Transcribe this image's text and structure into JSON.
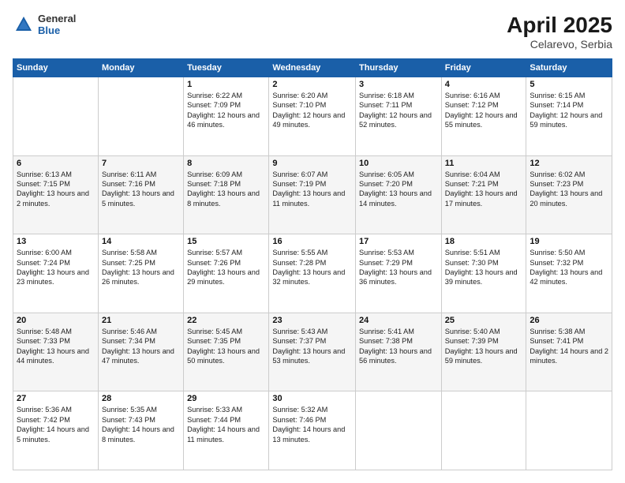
{
  "header": {
    "logo": {
      "general": "General",
      "blue": "Blue"
    },
    "title": "April 2025",
    "location": "Celarevo, Serbia"
  },
  "weekdays": [
    "Sunday",
    "Monday",
    "Tuesday",
    "Wednesday",
    "Thursday",
    "Friday",
    "Saturday"
  ],
  "weeks": [
    [
      null,
      null,
      {
        "day": "1",
        "sunrise": "6:22 AM",
        "sunset": "7:09 PM",
        "daylight": "12 hours and 46 minutes."
      },
      {
        "day": "2",
        "sunrise": "6:20 AM",
        "sunset": "7:10 PM",
        "daylight": "12 hours and 49 minutes."
      },
      {
        "day": "3",
        "sunrise": "6:18 AM",
        "sunset": "7:11 PM",
        "daylight": "12 hours and 52 minutes."
      },
      {
        "day": "4",
        "sunrise": "6:16 AM",
        "sunset": "7:12 PM",
        "daylight": "12 hours and 55 minutes."
      },
      {
        "day": "5",
        "sunrise": "6:15 AM",
        "sunset": "7:14 PM",
        "daylight": "12 hours and 59 minutes."
      }
    ],
    [
      {
        "day": "6",
        "sunrise": "6:13 AM",
        "sunset": "7:15 PM",
        "daylight": "13 hours and 2 minutes."
      },
      {
        "day": "7",
        "sunrise": "6:11 AM",
        "sunset": "7:16 PM",
        "daylight": "13 hours and 5 minutes."
      },
      {
        "day": "8",
        "sunrise": "6:09 AM",
        "sunset": "7:18 PM",
        "daylight": "13 hours and 8 minutes."
      },
      {
        "day": "9",
        "sunrise": "6:07 AM",
        "sunset": "7:19 PM",
        "daylight": "13 hours and 11 minutes."
      },
      {
        "day": "10",
        "sunrise": "6:05 AM",
        "sunset": "7:20 PM",
        "daylight": "13 hours and 14 minutes."
      },
      {
        "day": "11",
        "sunrise": "6:04 AM",
        "sunset": "7:21 PM",
        "daylight": "13 hours and 17 minutes."
      },
      {
        "day": "12",
        "sunrise": "6:02 AM",
        "sunset": "7:23 PM",
        "daylight": "13 hours and 20 minutes."
      }
    ],
    [
      {
        "day": "13",
        "sunrise": "6:00 AM",
        "sunset": "7:24 PM",
        "daylight": "13 hours and 23 minutes."
      },
      {
        "day": "14",
        "sunrise": "5:58 AM",
        "sunset": "7:25 PM",
        "daylight": "13 hours and 26 minutes."
      },
      {
        "day": "15",
        "sunrise": "5:57 AM",
        "sunset": "7:26 PM",
        "daylight": "13 hours and 29 minutes."
      },
      {
        "day": "16",
        "sunrise": "5:55 AM",
        "sunset": "7:28 PM",
        "daylight": "13 hours and 32 minutes."
      },
      {
        "day": "17",
        "sunrise": "5:53 AM",
        "sunset": "7:29 PM",
        "daylight": "13 hours and 36 minutes."
      },
      {
        "day": "18",
        "sunrise": "5:51 AM",
        "sunset": "7:30 PM",
        "daylight": "13 hours and 39 minutes."
      },
      {
        "day": "19",
        "sunrise": "5:50 AM",
        "sunset": "7:32 PM",
        "daylight": "13 hours and 42 minutes."
      }
    ],
    [
      {
        "day": "20",
        "sunrise": "5:48 AM",
        "sunset": "7:33 PM",
        "daylight": "13 hours and 44 minutes."
      },
      {
        "day": "21",
        "sunrise": "5:46 AM",
        "sunset": "7:34 PM",
        "daylight": "13 hours and 47 minutes."
      },
      {
        "day": "22",
        "sunrise": "5:45 AM",
        "sunset": "7:35 PM",
        "daylight": "13 hours and 50 minutes."
      },
      {
        "day": "23",
        "sunrise": "5:43 AM",
        "sunset": "7:37 PM",
        "daylight": "13 hours and 53 minutes."
      },
      {
        "day": "24",
        "sunrise": "5:41 AM",
        "sunset": "7:38 PM",
        "daylight": "13 hours and 56 minutes."
      },
      {
        "day": "25",
        "sunrise": "5:40 AM",
        "sunset": "7:39 PM",
        "daylight": "13 hours and 59 minutes."
      },
      {
        "day": "26",
        "sunrise": "5:38 AM",
        "sunset": "7:41 PM",
        "daylight": "14 hours and 2 minutes."
      }
    ],
    [
      {
        "day": "27",
        "sunrise": "5:36 AM",
        "sunset": "7:42 PM",
        "daylight": "14 hours and 5 minutes."
      },
      {
        "day": "28",
        "sunrise": "5:35 AM",
        "sunset": "7:43 PM",
        "daylight": "14 hours and 8 minutes."
      },
      {
        "day": "29",
        "sunrise": "5:33 AM",
        "sunset": "7:44 PM",
        "daylight": "14 hours and 11 minutes."
      },
      {
        "day": "30",
        "sunrise": "5:32 AM",
        "sunset": "7:46 PM",
        "daylight": "14 hours and 13 minutes."
      },
      null,
      null,
      null
    ]
  ],
  "labels": {
    "sunrise": "Sunrise:",
    "sunset": "Sunset:",
    "daylight": "Daylight:"
  }
}
